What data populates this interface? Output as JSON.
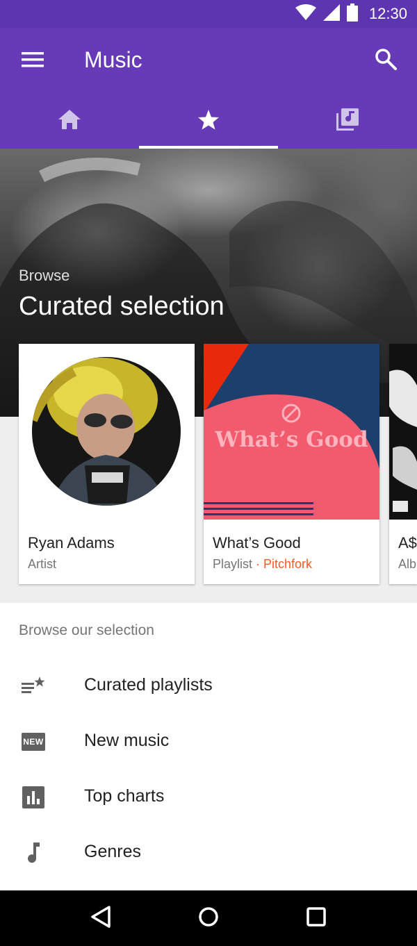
{
  "status_bar": {
    "time": "12:30",
    "icons": [
      "wifi-icon",
      "signal-icon",
      "battery-icon"
    ]
  },
  "app_bar": {
    "title": "Music",
    "color": "#673ab7",
    "status_color": "#5e35b1"
  },
  "tabs": [
    {
      "icon": "home-icon",
      "active": false
    },
    {
      "icon": "star-icon",
      "active": true
    },
    {
      "icon": "library-music-icon",
      "active": false
    }
  ],
  "hero": {
    "eyebrow": "Browse",
    "title": "Curated selection"
  },
  "cards": [
    {
      "title": "Ryan Adams",
      "subtitle": "Artist",
      "source": ""
    },
    {
      "title": "What’s Good",
      "subtitle": "Playlist",
      "source": "Pitchfork",
      "art_text": "What’s Good"
    },
    {
      "title": "A$",
      "subtitle": "Alb",
      "source": ""
    }
  ],
  "section": {
    "header": "Browse our selection",
    "items": [
      {
        "label": "Curated playlists",
        "icon": "playlist-star-icon"
      },
      {
        "label": "New music",
        "icon": "new-badge-icon",
        "badge": "NEW"
      },
      {
        "label": "Top charts",
        "icon": "bar-chart-icon"
      },
      {
        "label": "Genres",
        "icon": "music-note-icon"
      }
    ]
  },
  "accent_colors": {
    "pitchfork": "#ff5722",
    "playlist_pink": "#f25a6e",
    "playlist_navy": "#1d3f6e",
    "playlist_red": "#e8290c"
  }
}
